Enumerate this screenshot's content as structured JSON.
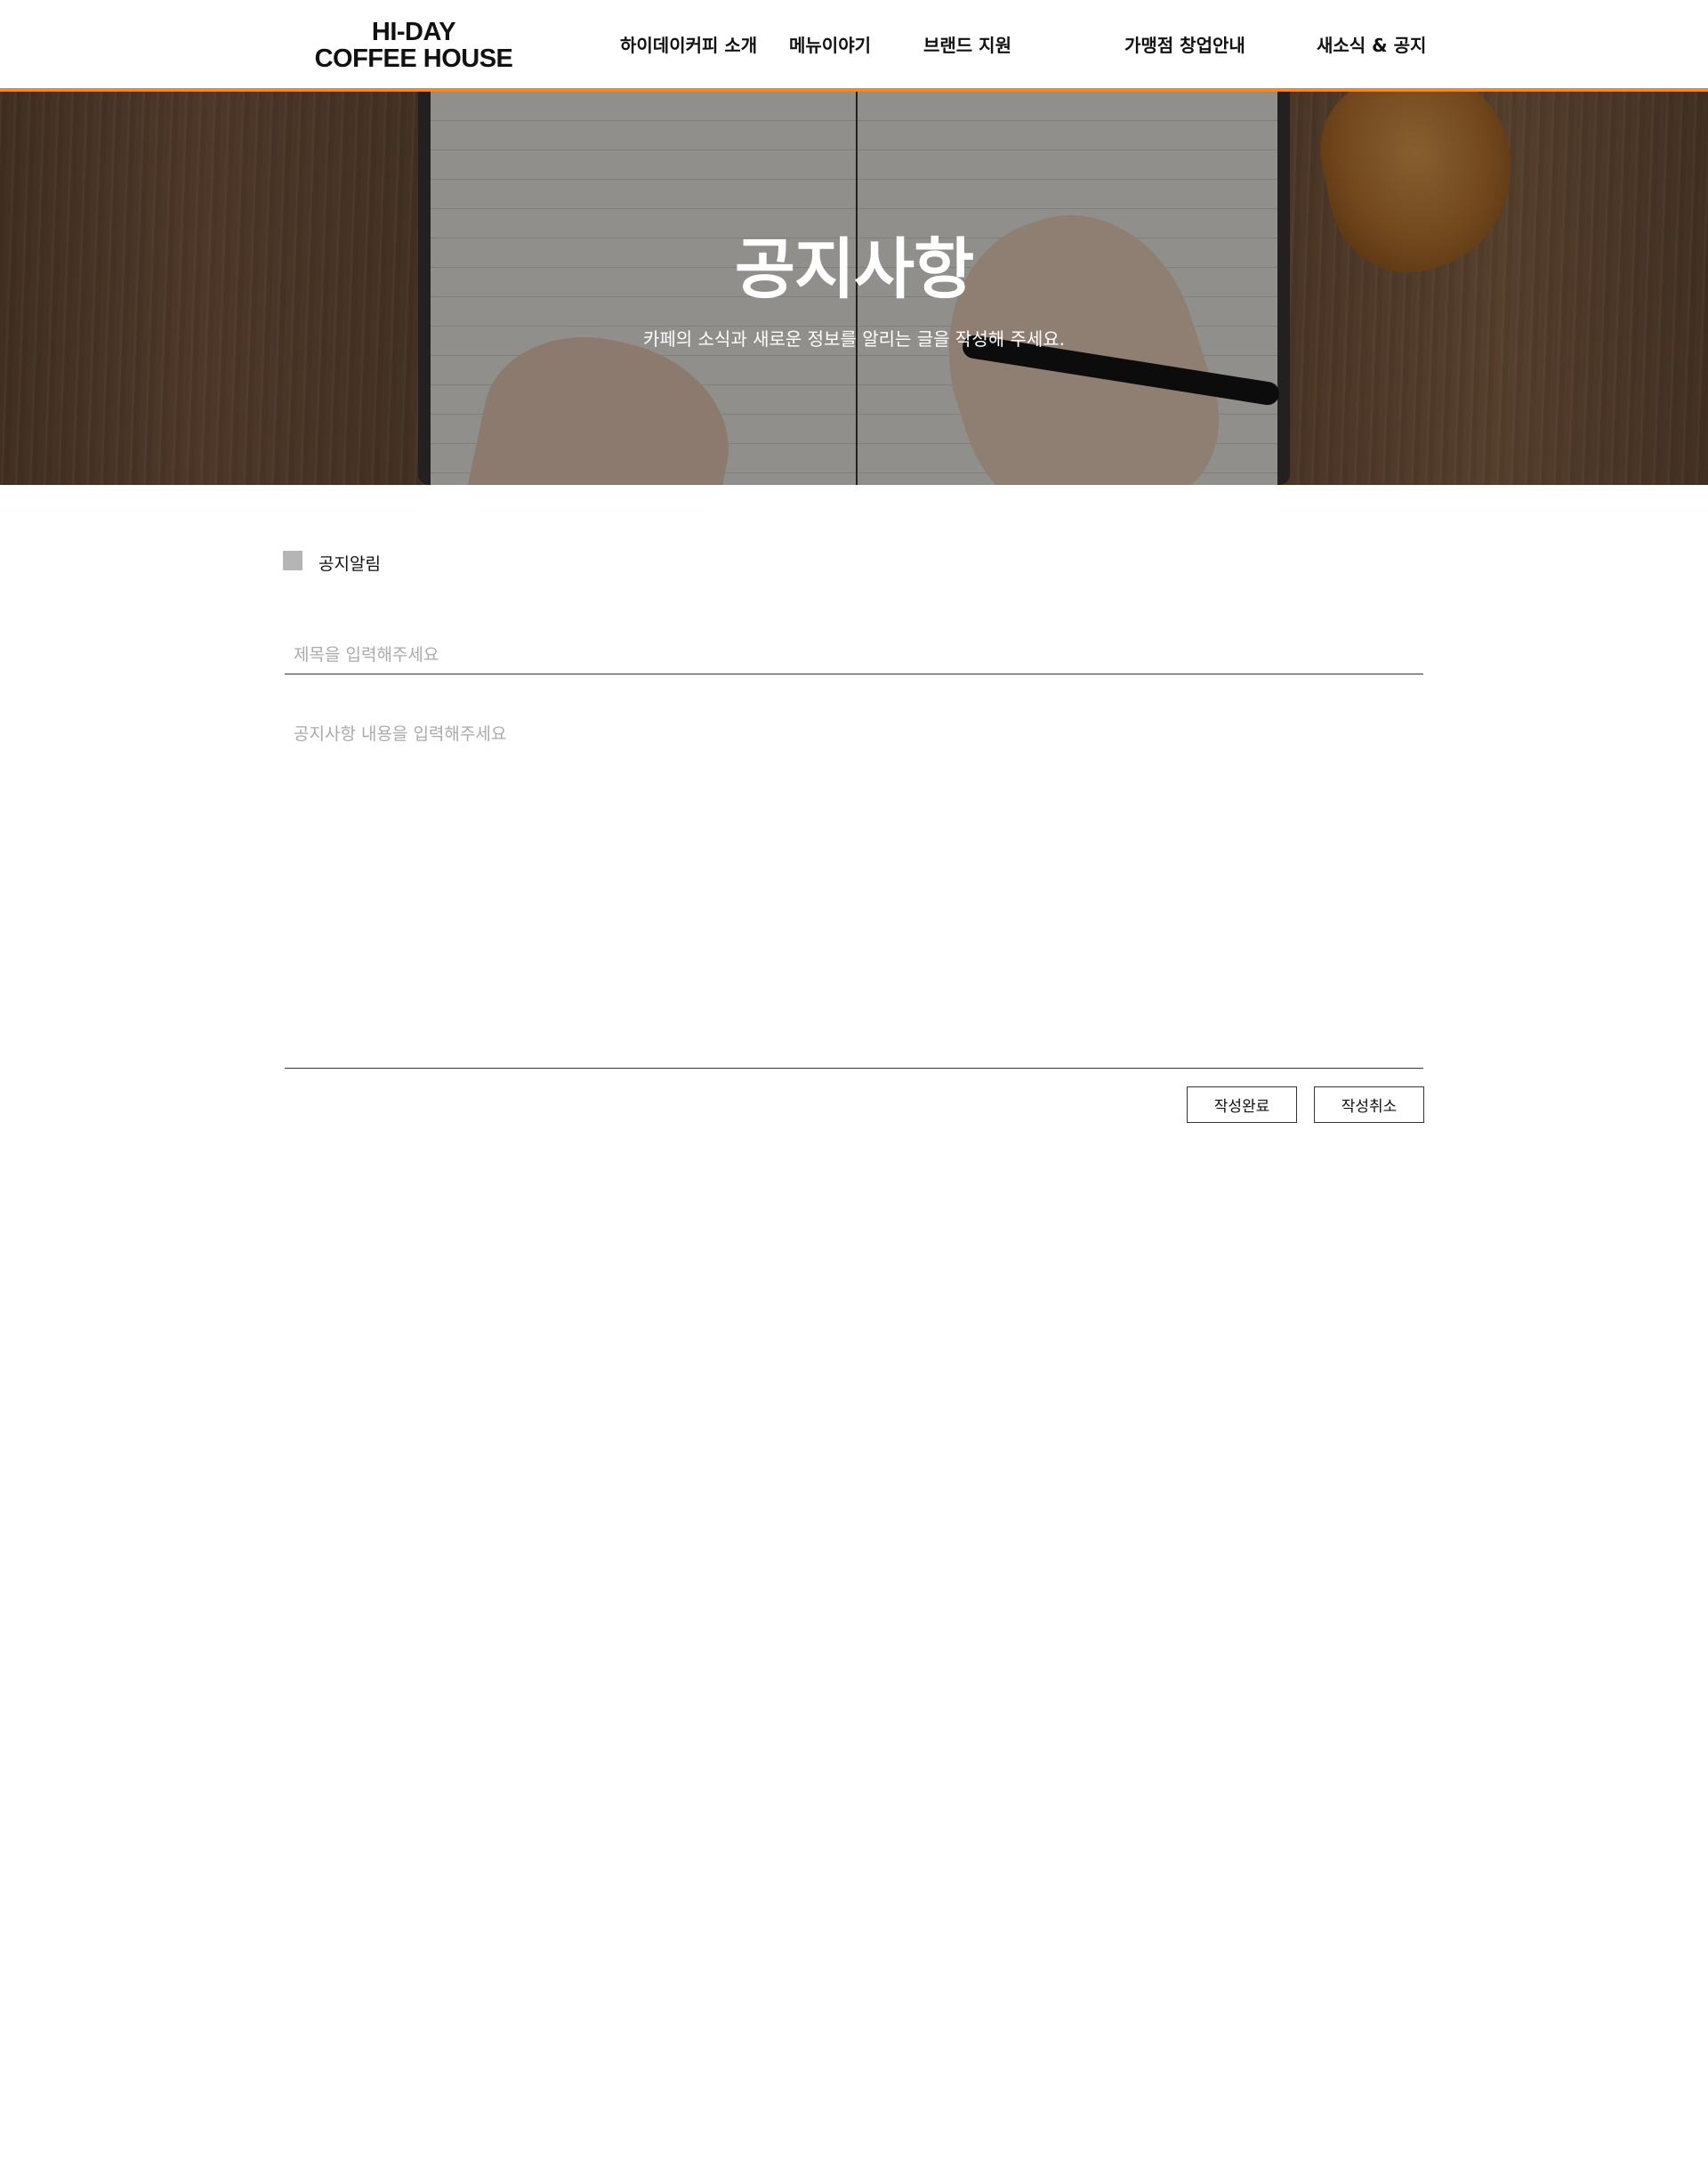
{
  "header": {
    "logo_line1": "HI-DAY",
    "logo_line2": "COFFEE HOUSE",
    "nav": [
      {
        "label": "하이데이커피 소개"
      },
      {
        "label": "메뉴이야기"
      },
      {
        "label": "브랜드 지원"
      },
      {
        "label": "가맹점 창업안내"
      },
      {
        "label": "새소식 & 공지"
      }
    ],
    "accent_color": "#f08a24"
  },
  "hero": {
    "title": "공지사항",
    "subtitle": "카페의 소식과 새로운 정보를 알리는 글을 작성해 주세요."
  },
  "form": {
    "notice_label": "공지알림",
    "notice_checked": false,
    "title_placeholder": "제목을 입력해주세요",
    "title_value": "",
    "content_placeholder": "공지사항 내용을 입력해주세요",
    "content_value": "",
    "submit_label": "작성완료",
    "cancel_label": "작성취소"
  }
}
